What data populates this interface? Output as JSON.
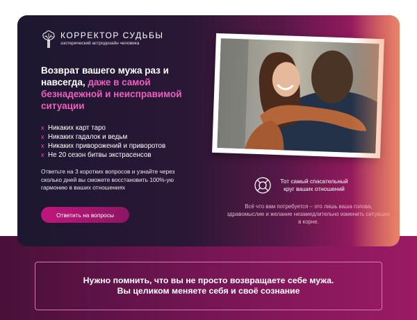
{
  "brand": {
    "name": "КОРРЕКТОР СУДЬБЫ",
    "tagline": "эзотерический астродизайн человека",
    "logo_icon": "tree-silhouette-icon"
  },
  "hero": {
    "headline_main": "Возврат вашего мужа раз и навсегда,",
    "headline_accent": "даже в самой безнадежной и неисправимой ситуации",
    "bullet_marker": "x",
    "bullets": [
      "Никаких карт таро",
      "Никаких гадалок и ведьм",
      "Никаких приворожений и приворотов",
      "Не 20 сезон битвы экстрасенсов"
    ],
    "description": "Ответьте на 3 коротких вопросов и узнайте через сколько дней вы сможете восстановить 100%-ую гармонию в ваших отношениях",
    "cta_label": "Ответить на вопросы"
  },
  "aside": {
    "icon": "lifebuoy-icon",
    "lifebuoy_text": "Тот самый спасательный круг ваших отношений",
    "note": "Всё что вам потребуется – это лишь ваша голова, здравомыслие и желание незамедлительно изменить ситуацию в корне."
  },
  "banner": {
    "line1": "Нужно помнить, что вы не просто возвращаете себе мужа.",
    "line2": "Вы целиком меняете себя и своё сознание"
  },
  "colors": {
    "accent_pink": "#ef5fc2",
    "button": "#c0167c",
    "dark_bg": "#1d1730",
    "magenta_bg": "#951a5e"
  }
}
